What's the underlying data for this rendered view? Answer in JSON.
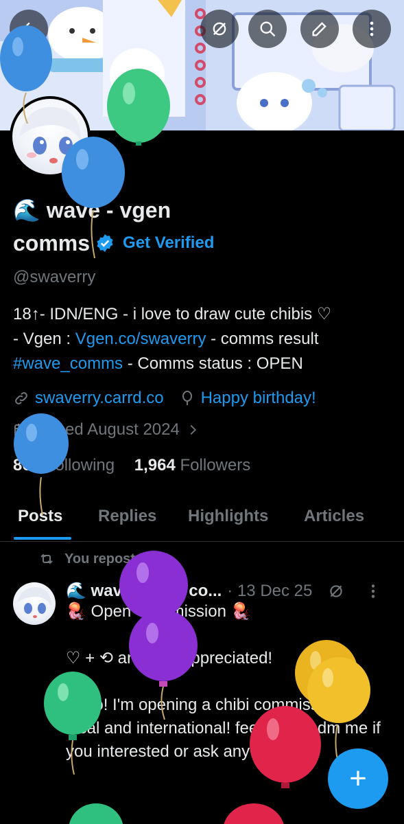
{
  "profile": {
    "name_emoji": "🌊",
    "name_line1": "wave - vgen",
    "name_line2": "comms",
    "get_verified": "Get Verified",
    "handle": "@swaverry",
    "bio": {
      "line1": "18↑- IDN/ENG - i love to draw cute chibis ♡",
      "line2_prefix": "- Vgen : ",
      "line2_link": "Vgen.co/swaverry",
      "line2_suffix": " - comms result",
      "line3_hashtag": "#wave_comms",
      "line3_suffix": " - Comms status : OPEN"
    },
    "website": "swaverry.carrd.co",
    "birthday": "Happy birthday!",
    "joined": "Joined August 2024",
    "following_count": "861",
    "following_label": "Following",
    "followers_count": "1,964",
    "followers_label": "Followers"
  },
  "tabs": [
    "Posts",
    "Replies",
    "Highlights",
    "Articles"
  ],
  "post": {
    "repost_label": "You reposted",
    "author": "🌊 wave - vgen co...",
    "date": "· 13 Dec 25",
    "text": "🪼 Open Commission 🪼\n\n♡ + ⟲ are very appreciated!\n\nHello! I'm opening a chibi commission for local and international! feel free to dm me if you interested or ask any info♡"
  },
  "fab_label": "+",
  "colors": {
    "accent": "#1d9bf0",
    "background": "#000000",
    "text": "#e7e9ea",
    "muted": "#71767b"
  }
}
